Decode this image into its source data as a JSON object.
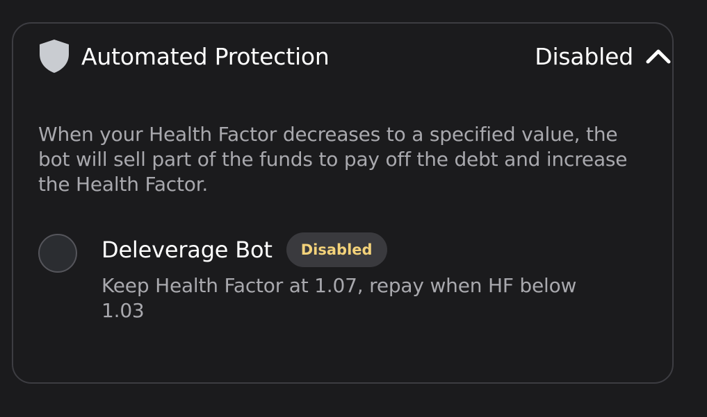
{
  "header": {
    "icon": "shield-icon",
    "title": "Automated Protection",
    "status": "Disabled",
    "toggle_icon": "chevron-up-icon"
  },
  "description": "When your Health Factor decreases to a specified value, the bot will sell part of the funds to pay off the debt and increase the Health Factor.",
  "bot": {
    "name": "Deleverage Bot",
    "badge": "Disabled",
    "description": "Keep Health Factor at 1.07, repay when HF below 1.03"
  },
  "colors": {
    "background": "#1b1b1d",
    "border": "#3d3d42",
    "text_primary": "#ffffff",
    "text_secondary": "#a9a9ae",
    "badge_bg": "#3a3a3e",
    "badge_text": "#f3d27a",
    "shield": "#c9ccd1"
  }
}
